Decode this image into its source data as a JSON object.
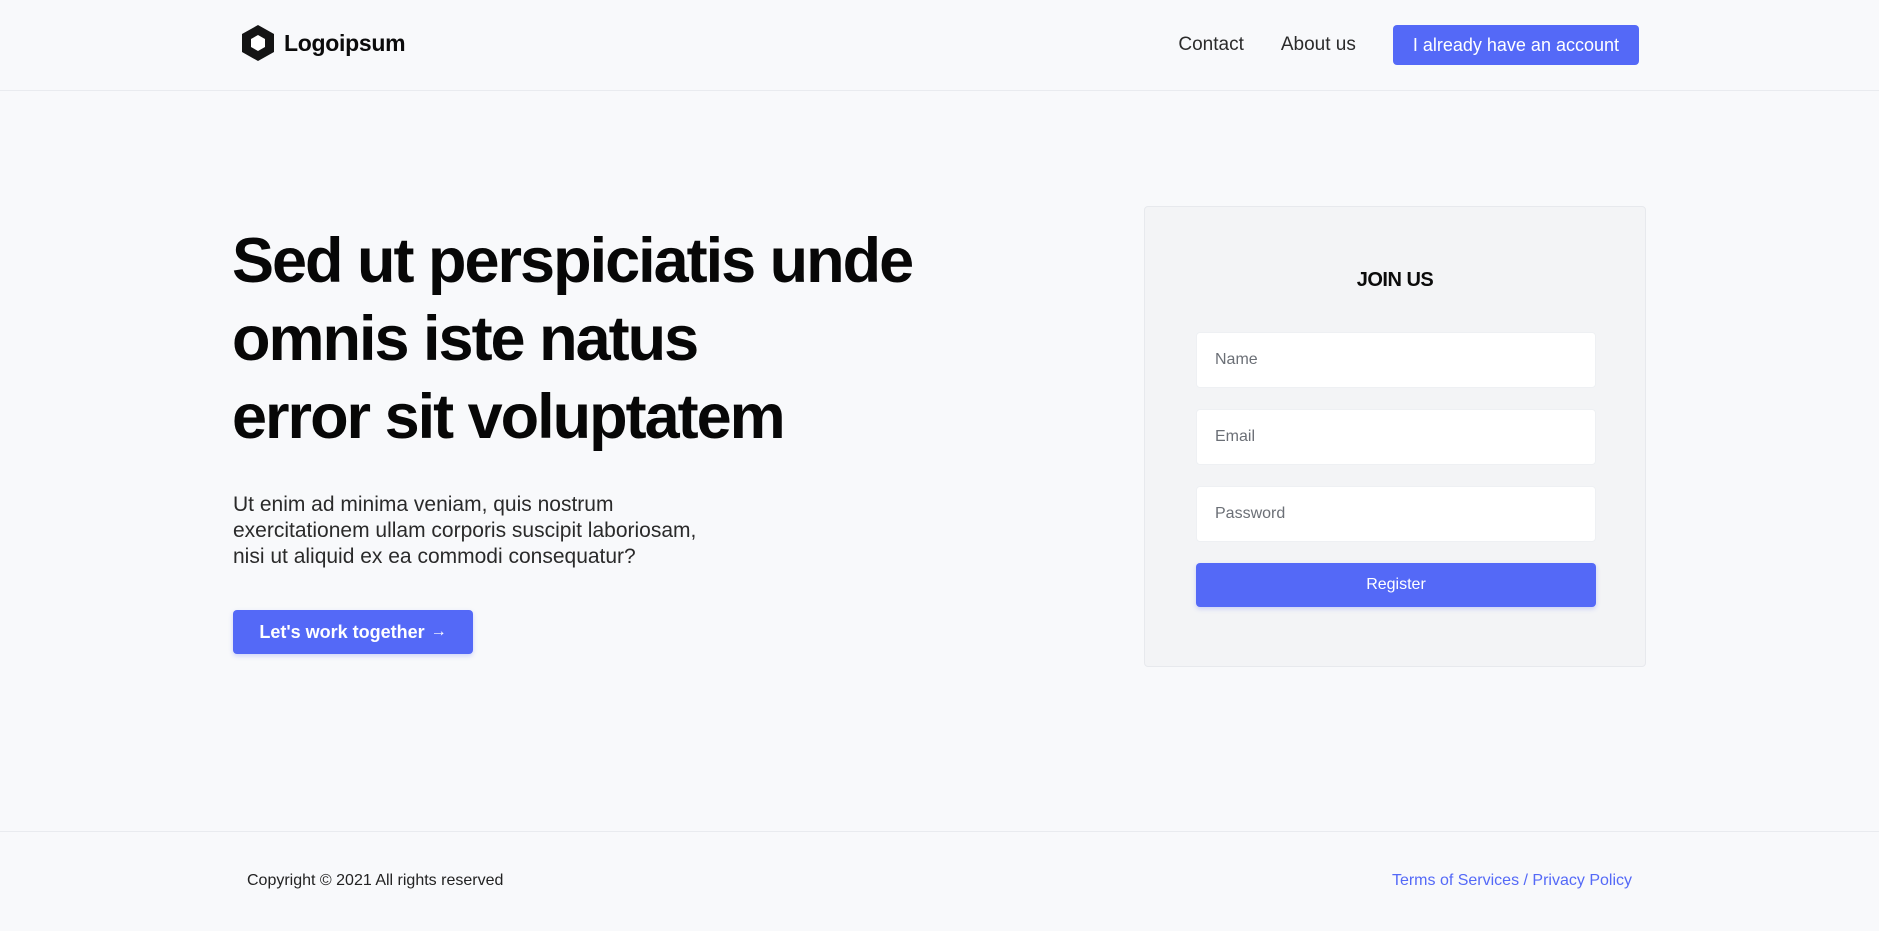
{
  "header": {
    "logo_text": "Logoipsum",
    "nav": [
      {
        "label": "Contact"
      },
      {
        "label": "About us"
      }
    ],
    "account_button": "I already have an account"
  },
  "hero": {
    "title_lines": [
      "Sed ut perspiciatis unde",
      "omnis iste natus",
      "error sit voluptatem"
    ],
    "text_lines": [
      "Ut enim ad minima veniam, quis nostrum",
      "exercitationem ullam corporis suscipit laboriosam,",
      "nisi ut aliquid ex ea commodi consequatur?"
    ],
    "cta_label": "Let's work together",
    "cta_icon": "→"
  },
  "form": {
    "title": "JOIN US",
    "name_placeholder": "Name",
    "email_placeholder": "Email",
    "password_placeholder": "Password",
    "register_label": "Register"
  },
  "footer": {
    "copyright": "Copyright © 2021 All rights reserved",
    "terms_label": "Terms of Services",
    "separator": " / ",
    "privacy_label": "Privacy Policy"
  },
  "colors": {
    "accent": "#5469f7",
    "background": "#f8f9fb",
    "card": "#f3f4f6"
  },
  "icons": {
    "logo": "hexagon-logo-icon",
    "cta": "arrow-right-icon"
  }
}
